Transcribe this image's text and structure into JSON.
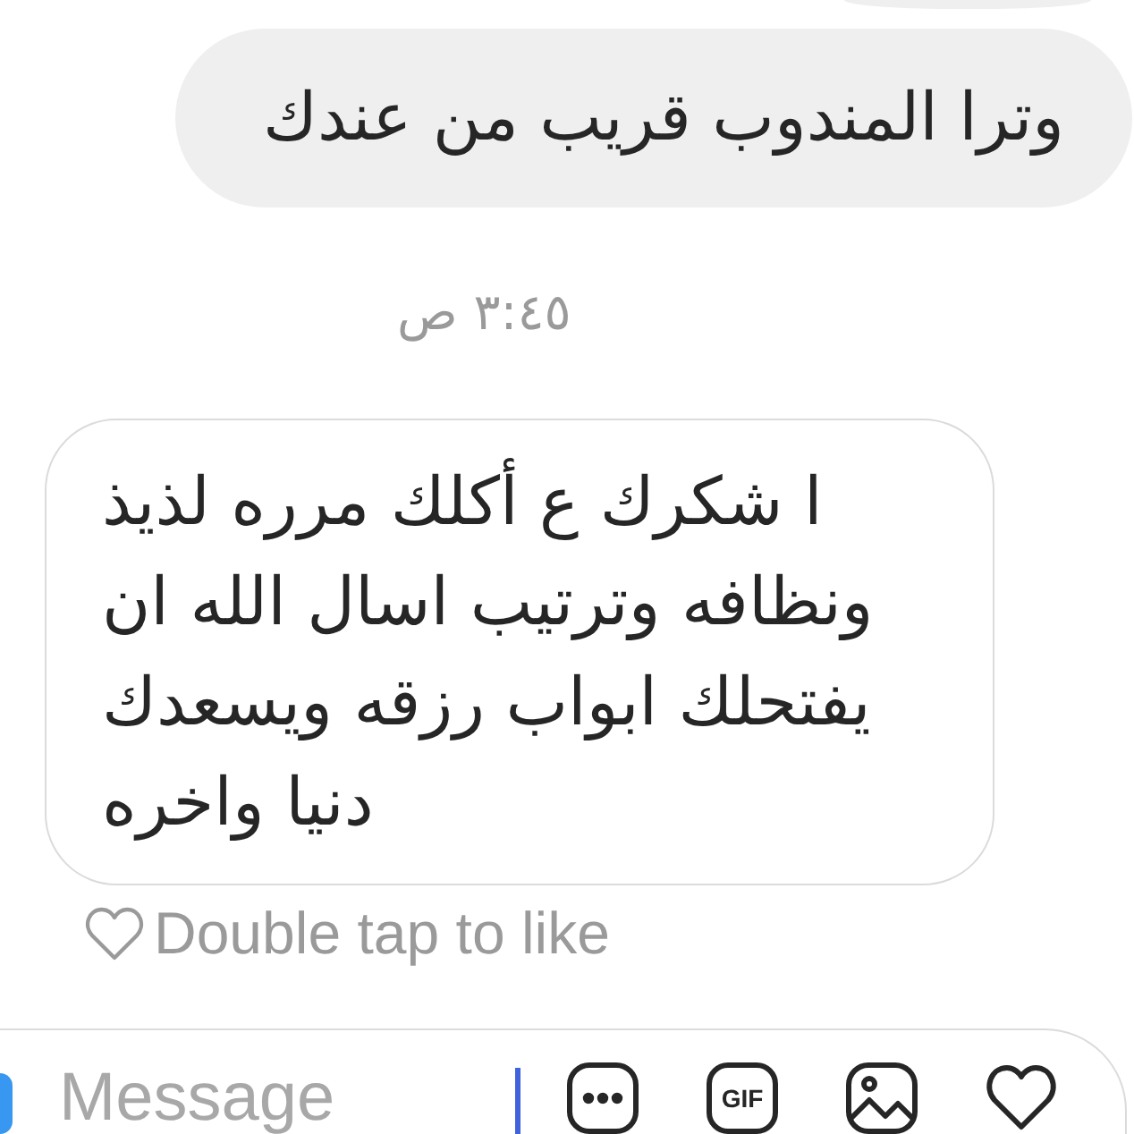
{
  "messages": [
    {
      "kind": "edge"
    },
    {
      "kind": "outgoing",
      "text": "وترا المندوب قريب من عندك"
    },
    {
      "kind": "timestamp",
      "text": "٣:٤٥ ص"
    },
    {
      "kind": "incoming",
      "text": "ا شكرك ع أكلك مرره لذيذ ونظافه وترتيب اسال الله ان يفتحلك ابواب رزقه ويسعدك دنيا واخره",
      "hint": "Double tap to like"
    }
  ],
  "composer": {
    "placeholder": "Message",
    "actions": [
      {
        "kind": "more"
      },
      {
        "kind": "gif",
        "label": "GIF"
      },
      {
        "kind": "image"
      },
      {
        "kind": "like"
      }
    ]
  }
}
